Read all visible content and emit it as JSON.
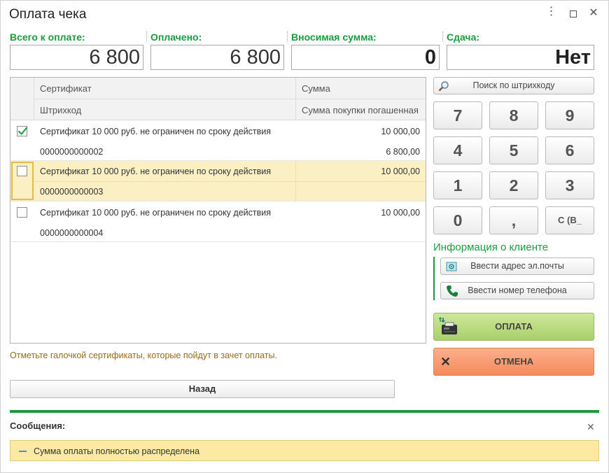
{
  "window": {
    "title": "Оплата чека"
  },
  "fields": {
    "total_label": "Всего к оплате:",
    "total_value": "6 800",
    "paid_label": "Оплачено:",
    "paid_value": "6 800",
    "deposit_label": "Вносимая сумма:",
    "deposit_value": "0",
    "change_label": "Сдача:",
    "change_value": "Нет"
  },
  "table": {
    "col_certificate": "Сертификат",
    "col_sum": "Сумма",
    "col_barcode": "Штрихкод",
    "col_paid_sum": "Сумма покупки погашенная",
    "rows": [
      {
        "name": "Сертификат 10 000 руб. не ограничен по сроку действия",
        "barcode": "0000000000002",
        "sum": "10 000,00",
        "paid": "6 800,00",
        "checked": true
      },
      {
        "name": "Сертификат 10 000 руб. не ограничен по сроку действия",
        "barcode": "0000000000003",
        "sum": "10 000,00",
        "paid": "",
        "checked": false
      },
      {
        "name": "Сертификат 10 000 руб. не ограничен по сроку действия",
        "barcode": "0000000000004",
        "sum": "10 000,00",
        "paid": "",
        "checked": false
      }
    ]
  },
  "hint": "Отметьте галочкой сертификаты, которые пойдут в зачет оплаты.",
  "back_button": "Назад",
  "search_button": "Поиск по штрихкоду",
  "keypad": [
    "7",
    "8",
    "9",
    "4",
    "5",
    "6",
    "1",
    "2",
    "3",
    "0",
    ",",
    "С (В_"
  ],
  "client_info": {
    "title": "Информация о клиенте",
    "email_button": "Ввести адрес эл.почты",
    "phone_button": "Ввести номер телефона"
  },
  "pay_button": "ОПЛАТА",
  "cancel_button": "ОТМЕНА",
  "messages": {
    "title": "Сообщения:",
    "items": [
      "Сумма оплаты полностью распределена"
    ]
  },
  "colors": {
    "accent_green": "#1a9c3e",
    "selected_row": "#fbf0c4",
    "pay": "#b9da7e",
    "cancel": "#f79b72"
  }
}
